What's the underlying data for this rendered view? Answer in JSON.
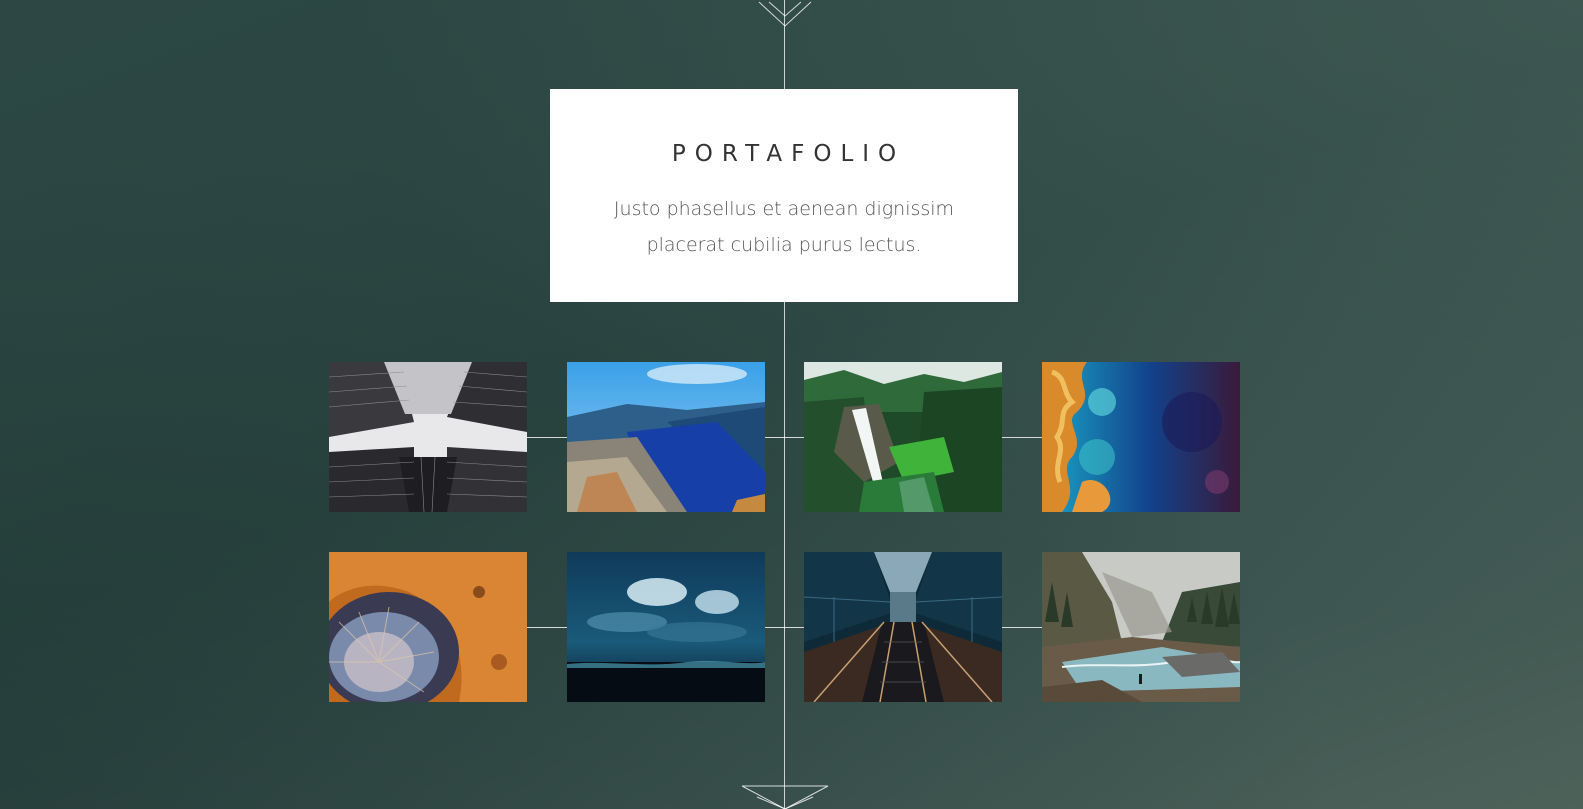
{
  "header": {
    "title": "PORTAFOLIO",
    "description": "Justo phasellus et aenean dignissim placerat cubilia purus lectus."
  },
  "gallery": {
    "items": [
      {
        "name": "skyscrapers",
        "icon": "skyscrapers-image"
      },
      {
        "name": "fjord",
        "icon": "fjord-image"
      },
      {
        "name": "waterfall",
        "icon": "waterfall-image"
      },
      {
        "name": "aerial-coast",
        "icon": "aerial-coast-image"
      },
      {
        "name": "crater",
        "icon": "crater-image"
      },
      {
        "name": "stormy-sea",
        "icon": "stormy-sea-image"
      },
      {
        "name": "escalator",
        "icon": "escalator-image"
      },
      {
        "name": "mountain-river",
        "icon": "mountain-river-image"
      }
    ]
  },
  "colors": {
    "background": "#2d4844",
    "card": "#ffffff",
    "line": "#ffffff"
  }
}
